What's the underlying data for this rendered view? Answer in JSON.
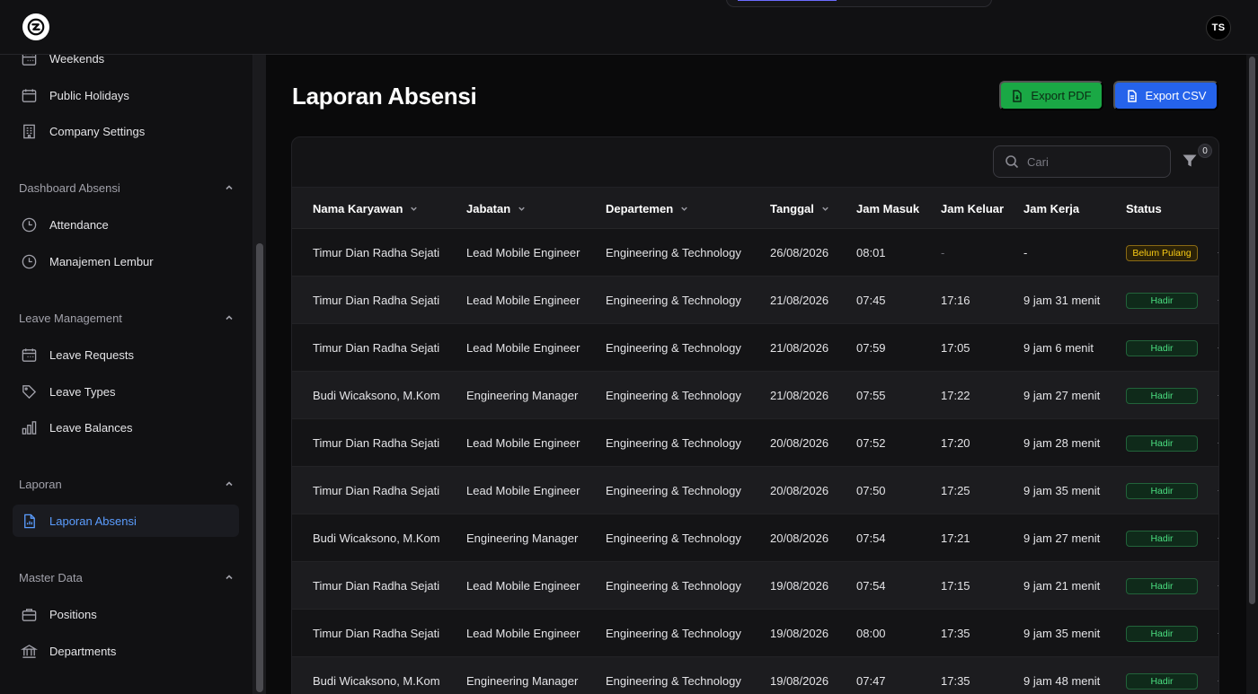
{
  "header": {
    "avatar_initials": "TS"
  },
  "sidebar": {
    "top_items": [
      {
        "label": "Weekends",
        "icon": "calendar-grid-icon"
      },
      {
        "label": "Public Holidays",
        "icon": "calendar-icon"
      },
      {
        "label": "Company Settings",
        "icon": "building-icon"
      }
    ],
    "groups": [
      {
        "label": "Dashboard Absensi",
        "items": [
          {
            "label": "Attendance",
            "icon": "clock-icon"
          },
          {
            "label": "Manajemen Lembur",
            "icon": "clock-icon"
          }
        ]
      },
      {
        "label": "Leave Management",
        "items": [
          {
            "label": "Leave Requests",
            "icon": "calendar-grid-icon"
          },
          {
            "label": "Leave Types",
            "icon": "tag-icon"
          },
          {
            "label": "Leave Balances",
            "icon": "bar-chart-icon"
          }
        ]
      },
      {
        "label": "Laporan",
        "items": [
          {
            "label": "Laporan Absensi",
            "icon": "report-file-icon",
            "active": true
          }
        ]
      },
      {
        "label": "Master Data",
        "items": [
          {
            "label": "Positions",
            "icon": "briefcase-icon"
          },
          {
            "label": "Departments",
            "icon": "bank-icon"
          }
        ]
      }
    ]
  },
  "main": {
    "title": "Laporan Absensi",
    "export_pdf_label": "Export PDF",
    "export_csv_label": "Export CSV",
    "search_placeholder": "Cari",
    "filter_count": "0",
    "columns": [
      "Nama Karyawan",
      "Jabatan",
      "Departemen",
      "Tanggal",
      "Jam Masuk",
      "Jam Keluar",
      "Jam Kerja",
      "Status"
    ],
    "rows": [
      [
        "Timur Dian Radha Sejati",
        "Lead Mobile Engineer",
        "Engineering & Technology",
        "26/08/2026",
        "08:01",
        "-",
        "-",
        "Belum Pulang"
      ],
      [
        "Timur Dian Radha Sejati",
        "Lead Mobile Engineer",
        "Engineering & Technology",
        "21/08/2026",
        "07:45",
        "17:16",
        "9 jam 31 menit",
        "Hadir"
      ],
      [
        "Timur Dian Radha Sejati",
        "Lead Mobile Engineer",
        "Engineering & Technology",
        "21/08/2026",
        "07:59",
        "17:05",
        "9 jam 6 menit",
        "Hadir"
      ],
      [
        "Budi Wicaksono, M.Kom",
        "Engineering Manager",
        "Engineering & Technology",
        "21/08/2026",
        "07:55",
        "17:22",
        "9 jam 27 menit",
        "Hadir"
      ],
      [
        "Timur Dian Radha Sejati",
        "Lead Mobile Engineer",
        "Engineering & Technology",
        "20/08/2026",
        "07:52",
        "17:20",
        "9 jam 28 menit",
        "Hadir"
      ],
      [
        "Timur Dian Radha Sejati",
        "Lead Mobile Engineer",
        "Engineering & Technology",
        "20/08/2026",
        "07:50",
        "17:25",
        "9 jam 35 menit",
        "Hadir"
      ],
      [
        "Budi Wicaksono, M.Kom",
        "Engineering Manager",
        "Engineering & Technology",
        "20/08/2026",
        "07:54",
        "17:21",
        "9 jam 27 menit",
        "Hadir"
      ],
      [
        "Timur Dian Radha Sejati",
        "Lead Mobile Engineer",
        "Engineering & Technology",
        "19/08/2026",
        "07:54",
        "17:15",
        "9 jam 21 menit",
        "Hadir"
      ],
      [
        "Timur Dian Radha Sejati",
        "Lead Mobile Engineer",
        "Engineering & Technology",
        "19/08/2026",
        "08:00",
        "17:35",
        "9 jam 35 menit",
        "Hadir"
      ],
      [
        "Budi Wicaksono, M.Kom",
        "Engineering Manager",
        "Engineering & Technology",
        "19/08/2026",
        "07:47",
        "17:35",
        "9 jam 48 menit",
        "Hadir"
      ]
    ]
  },
  "colors": {
    "accent_blue": "#2563eb",
    "accent_green": "#1aa845",
    "status_hadir": "#4ade80",
    "status_pending": "#facc15"
  }
}
